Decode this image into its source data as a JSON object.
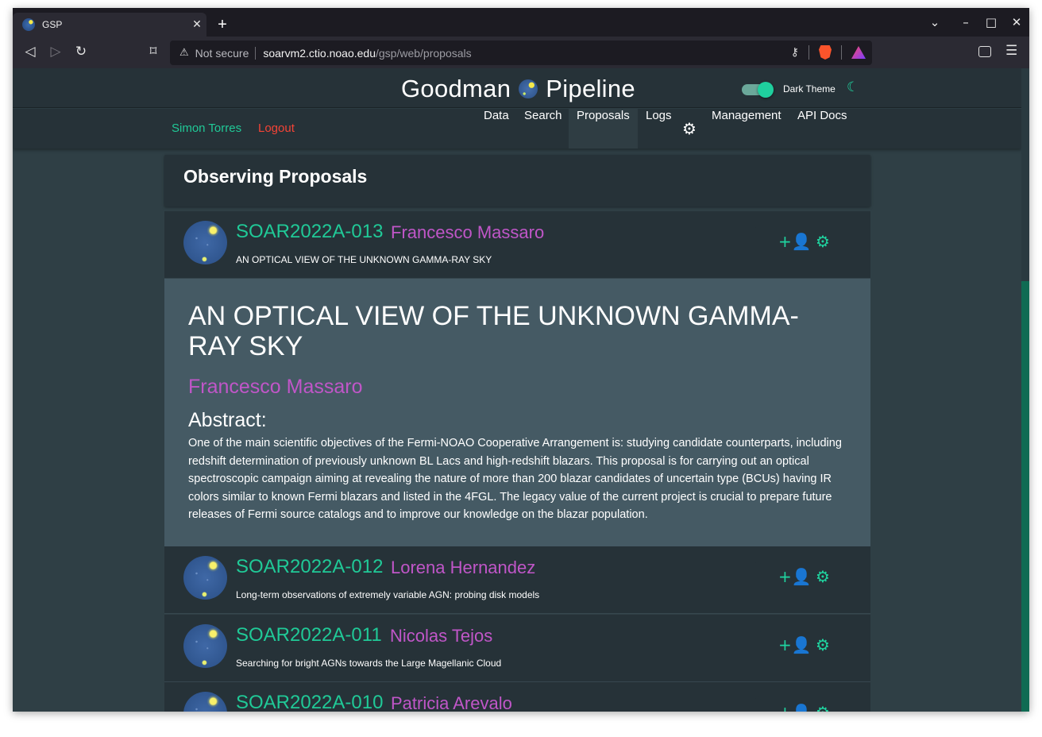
{
  "browser": {
    "tab_title": "GSP",
    "security_label": "Not secure",
    "url_host": "soarvm2.ctio.noao.edu",
    "url_path": "/gsp/web/proposals",
    "rewards_badge": "1"
  },
  "app": {
    "brand_left": "Goodman",
    "brand_right": "Pipeline",
    "theme_label": "Dark Theme",
    "theme_toggle_on": true,
    "user_name": "Simon Torres",
    "logout_label": "Logout",
    "nav": [
      "Data",
      "Search",
      "Proposals",
      "Logs",
      "Management",
      "API Docs"
    ],
    "active_nav": "Proposals"
  },
  "page": {
    "heading": "Observing Proposals"
  },
  "proposals": [
    {
      "code": "SOAR2022A-013",
      "pi": "Francesco Massaro",
      "title": "AN OPTICAL VIEW OF THE UNKNOWN GAMMA-RAY SKY"
    },
    {
      "code": "SOAR2022A-012",
      "pi": "Lorena Hernandez",
      "title": "Long-term observations of extremely variable AGN: probing disk models"
    },
    {
      "code": "SOAR2022A-011",
      "pi": "Nicolas Tejos",
      "title": "Searching for bright AGNs towards the Large Magellanic Cloud"
    },
    {
      "code": "SOAR2022A-010",
      "pi": "Patricia Arevalo",
      "title": ""
    }
  ],
  "detail": {
    "title": "AN OPTICAL VIEW OF THE UNKNOWN GAMMA-RAY SKY",
    "pi": "Francesco Massaro",
    "abstract_heading": "Abstract:",
    "abstract": "One of the main scientific objectives of the Fermi-NOAO Cooperative Arrangement is: studying candidate counterparts, including redshift determination of previously unknown BL Lacs and high-redshift blazars. This proposal is for carrying out an optical spectroscopic campaign aiming at revealing the nature of more than 200 blazar candidates of uncertain type (BCUs) having IR colors similar to known Fermi blazars and listed in the 4FGL. The legacy value of the current project is crucial to prepare future releases of Fermi source catalogs and to improve our knowledge on the blazar population."
  },
  "icons": {
    "accent": "#20c997",
    "pi_color": "#c056c8",
    "logout_color": "#f44336",
    "action_icons": [
      "image-icon",
      "person-add-icon",
      "gear-icon"
    ]
  }
}
